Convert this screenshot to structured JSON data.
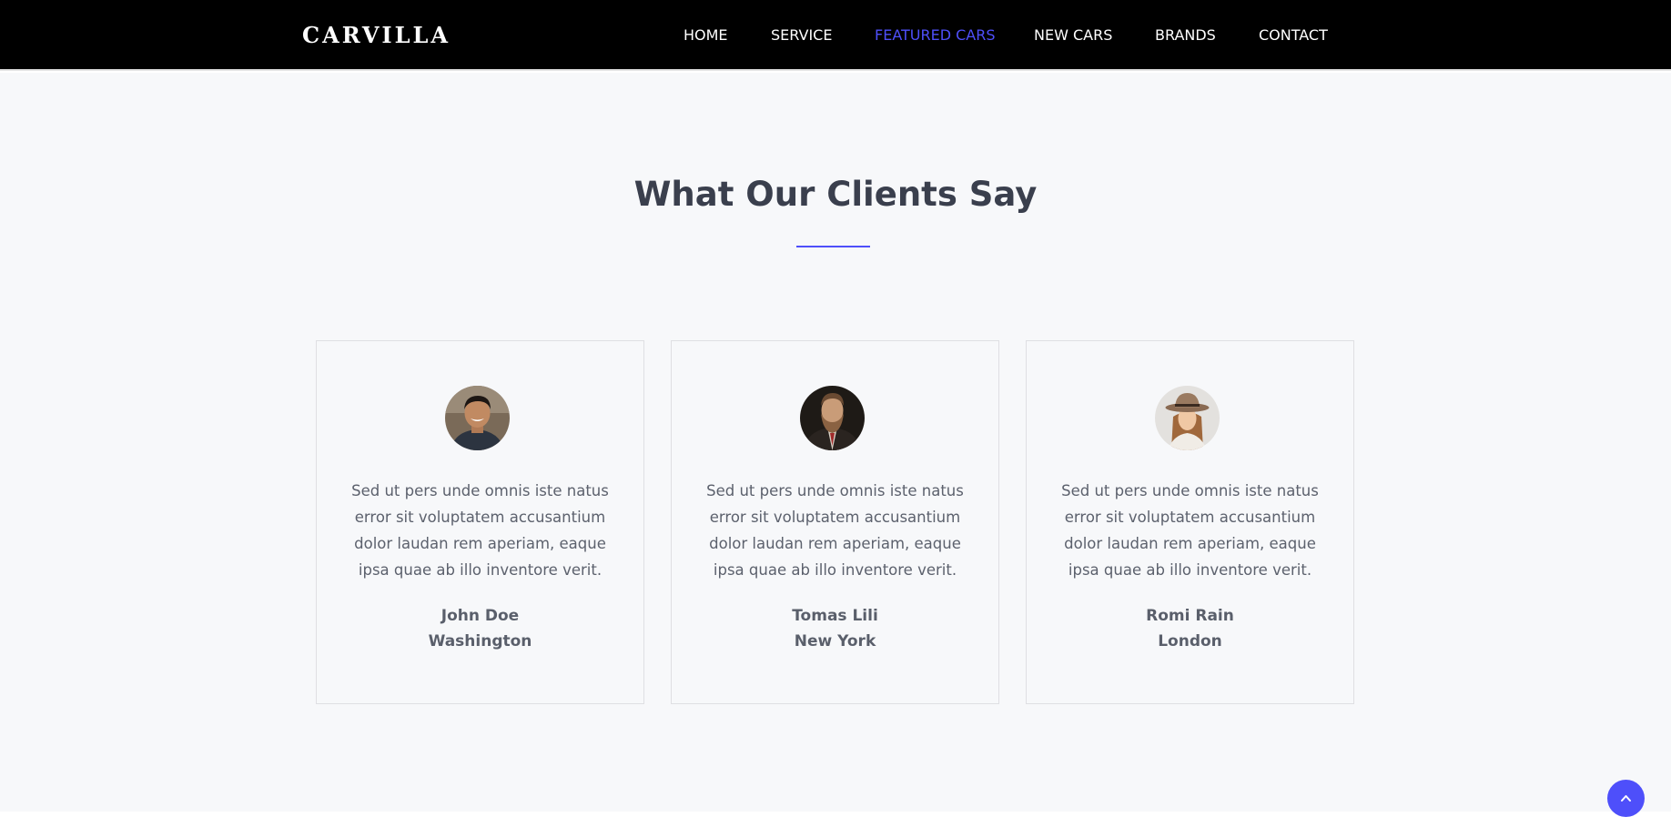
{
  "header": {
    "logo": "CARVILLA",
    "nav": [
      {
        "label": "HOME"
      },
      {
        "label": "SERVICE"
      },
      {
        "label": "FEATURED CARS"
      },
      {
        "label": "NEW CARS"
      },
      {
        "label": "BRANDS"
      },
      {
        "label": "CONTACT"
      }
    ],
    "active_nav": "FEATURED CARS",
    "accent_color": "#4e4ffa"
  },
  "clients": {
    "title": "What Our Clients Say",
    "testimonials": [
      {
        "quote": "Sed ut pers unde omnis iste natus error sit voluptatem accusantium dolor laudan rem aperiam, eaque ipsa quae ab illo inventore verit.",
        "name": "John Doe",
        "city": "Washington",
        "avatar": "client-photo-man-smiling"
      },
      {
        "quote": "Sed ut pers unde omnis iste natus error sit voluptatem accusantium dolor laudan rem aperiam, eaque ipsa quae ab illo inventore verit.",
        "name": "Tomas Lili",
        "city": "New York",
        "avatar": "client-photo-bearded-man"
      },
      {
        "quote": "Sed ut pers unde omnis iste natus error sit voluptatem accusantium dolor laudan rem aperiam, eaque ipsa quae ab illo inventore verit.",
        "name": "Romi Rain",
        "city": "London",
        "avatar": "client-photo-woman-hat"
      }
    ]
  },
  "scroll_top": {
    "icon": "chevron-up-icon"
  }
}
